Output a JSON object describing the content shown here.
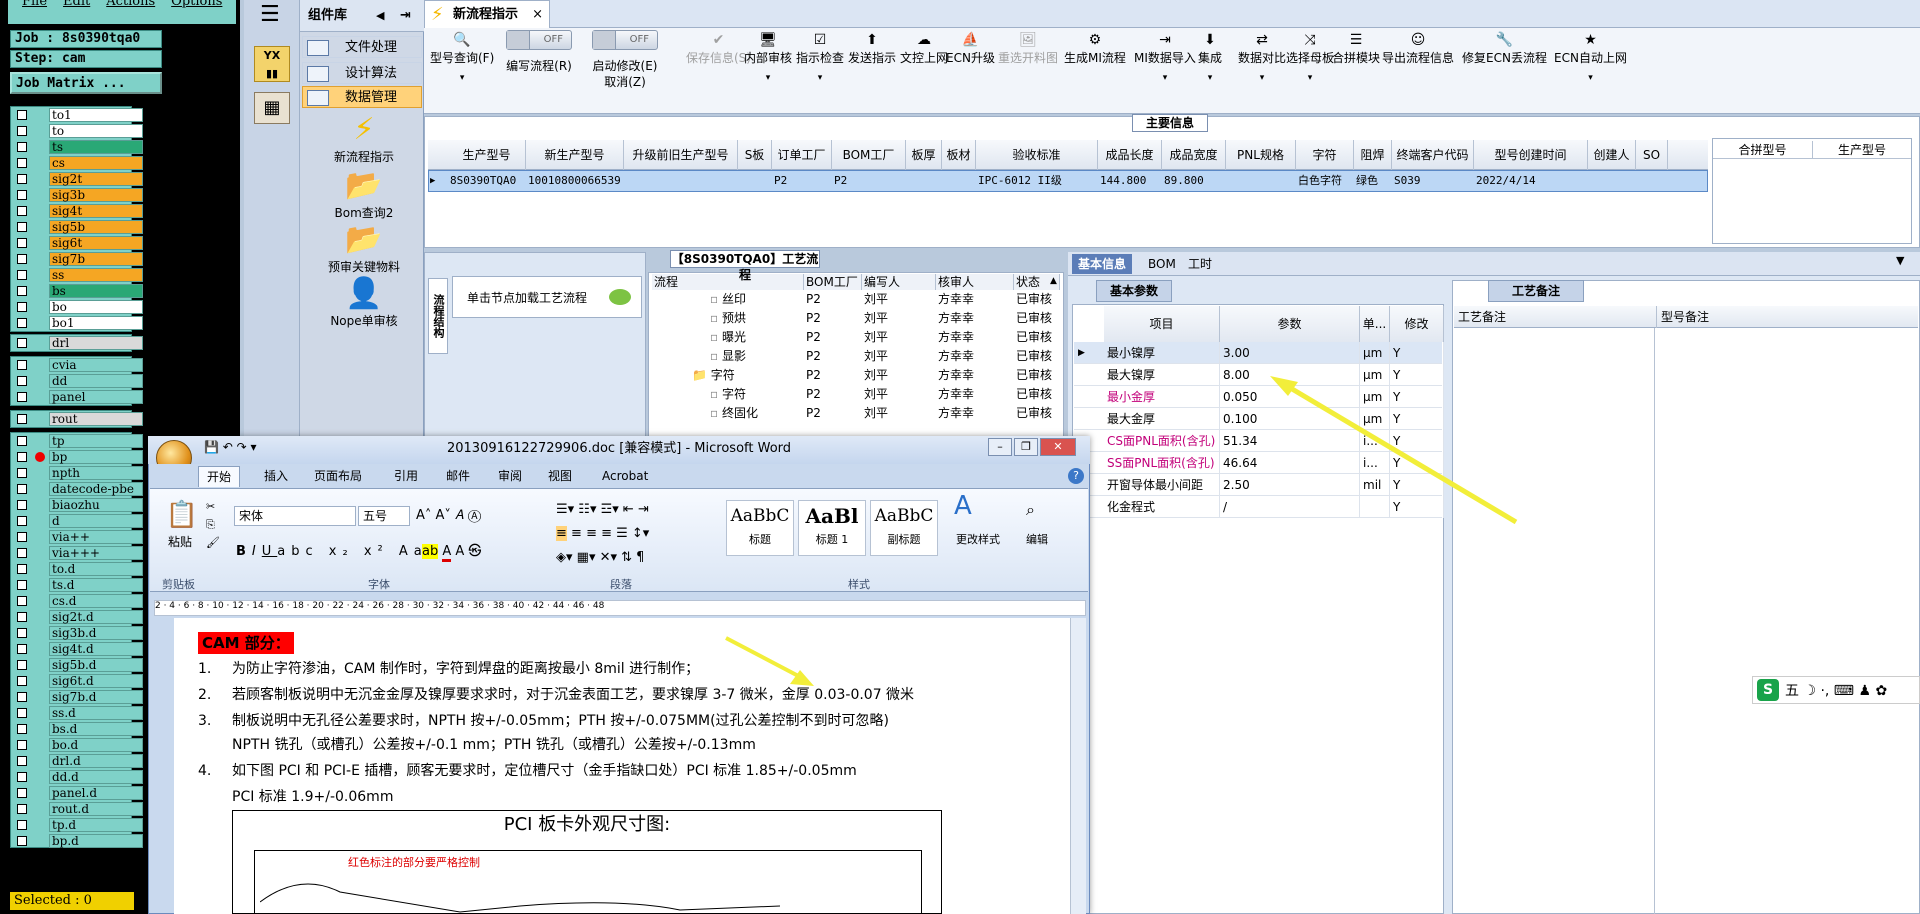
{
  "genesis": {
    "menu": [
      "File",
      "Edit",
      "Actions",
      "Options"
    ],
    "job_label": "Job : 8s0390tqa0",
    "step_label": "Step: cam",
    "matrix_button": "Job Matrix ...",
    "layers": [
      {
        "name": "to1",
        "style": "white",
        "arrow": ""
      },
      {
        "name": "to",
        "style": "white",
        "arrow": "↲"
      },
      {
        "name": "ts",
        "style": "green",
        "arrow": "↲"
      },
      {
        "name": "cs",
        "style": "orange",
        "arrow": "↲"
      },
      {
        "name": "sig2t",
        "style": "orange",
        "arrow": "↲"
      },
      {
        "name": "sig3b",
        "style": "orange",
        "arrow": "↲"
      },
      {
        "name": "sig4t",
        "style": "orange",
        "arrow": "↲"
      },
      {
        "name": "sig5b",
        "style": "orange",
        "arrow": "↲"
      },
      {
        "name": "sig6t",
        "style": "orange",
        "arrow": "↲"
      },
      {
        "name": "sig7b",
        "style": "orange",
        "arrow": "↲"
      },
      {
        "name": "ss",
        "style": "orange",
        "arrow": "↲"
      },
      {
        "name": "bs",
        "style": "green",
        "arrow": "↲"
      },
      {
        "name": "bo",
        "style": "white",
        "arrow": "↲"
      },
      {
        "name": "bo1",
        "style": "white",
        "arrow": ""
      }
    ],
    "drill_layers": [
      {
        "name": "drl",
        "style": "grey",
        "arrow": ""
      }
    ],
    "misc_layers": [
      {
        "name": "cvia",
        "style": "plain",
        "arrow": ""
      },
      {
        "name": "dd",
        "style": "plain",
        "arrow": "↲"
      },
      {
        "name": "panel",
        "style": "plain",
        "arrow": ""
      }
    ],
    "rout_layers": [
      {
        "name": "rout",
        "style": "grey",
        "arrow": ""
      }
    ],
    "doc_layers": [
      "tp",
      "bp",
      "npth",
      "datecode-pbe",
      "biaozhu",
      "d",
      "via++",
      "via+++",
      "to.d",
      "ts.d",
      "cs.d",
      "sig2t.d",
      "sig3b.d",
      "sig4t.d",
      "sig5b.d",
      "sig6t.d",
      "sig7b.d",
      "ss.d",
      "bs.d",
      "bo.d",
      "drl.d",
      "dd.d",
      "panel.d",
      "rout.d",
      "tp.d",
      "bp.d"
    ],
    "selected": "Selected : 0"
  },
  "sidebar": {
    "title": "组件库",
    "items": [
      {
        "label": "文件处理"
      },
      {
        "label": "设计算法"
      },
      {
        "label": "数据管理",
        "active": true
      }
    ],
    "tools": [
      {
        "label": "新流程指示",
        "icon": "lightning-icon",
        "glyph": "⚡"
      },
      {
        "label": "Bom查询2",
        "icon": "folder-icon",
        "glyph": "📂"
      },
      {
        "label": "预审关键物料",
        "icon": "folder-icon",
        "glyph": "📂"
      },
      {
        "label": "Nope单审核",
        "icon": "user-icon",
        "glyph": "👤"
      }
    ]
  },
  "tab": {
    "title": "新流程指示"
  },
  "toolbar": {
    "buttons": [
      {
        "label": "型号查询(F)",
        "icon": "🔍",
        "dd": true,
        "disabled": false
      },
      {
        "label": "保存信息(S)",
        "icon": "✔",
        "dd": false,
        "disabled": true
      },
      {
        "label": "内部审核",
        "icon": "🖥",
        "dd": true,
        "disabled": false
      },
      {
        "label": "指示检查",
        "icon": "☑",
        "dd": true,
        "disabled": false
      },
      {
        "label": "发送指示",
        "icon": "⬆",
        "dd": false,
        "disabled": false
      },
      {
        "label": "文控上网",
        "icon": "☁",
        "dd": false,
        "disabled": false
      },
      {
        "label": "ECN升级",
        "icon": "⛵",
        "dd": false,
        "disabled": false
      },
      {
        "label": "重选开料图",
        "icon": "🖼",
        "dd": false,
        "disabled": true
      },
      {
        "label": "生成MI流程",
        "icon": "⚙",
        "dd": false,
        "disabled": false
      },
      {
        "label": "MI数据导入",
        "icon": "⇥",
        "dd": true,
        "disabled": false
      },
      {
        "label": "集成",
        "icon": "⬇",
        "dd": true,
        "disabled": false
      },
      {
        "label": "数据对比",
        "icon": "⇄",
        "dd": true,
        "disabled": false
      },
      {
        "label": "选择母板",
        "icon": "⤨",
        "dd": true,
        "disabled": false
      },
      {
        "label": "合拼模块",
        "icon": "☰",
        "dd": false,
        "disabled": false
      },
      {
        "label": "导出流程信息",
        "icon": "☺",
        "dd": false,
        "disabled": false
      },
      {
        "label": "修复ECN丢流程",
        "icon": "🔧",
        "dd": false,
        "disabled": false
      },
      {
        "label": "ECN自动上网",
        "icon": "★",
        "dd": true,
        "disabled": false
      }
    ],
    "toggle1": {
      "label": "编写流程(R)",
      "state": "OFF"
    },
    "toggle2": {
      "label": "启动修改(E)",
      "state": "OFF",
      "sub": "取消(Z)"
    }
  },
  "main_info": {
    "title": "主要信息",
    "columns": [
      "生产型号",
      "新生产型号",
      "升级前旧生产型号",
      "S板",
      "订单工厂",
      "BOM工厂",
      "板厚",
      "板材",
      "验收标准",
      "成品长度",
      "成品宽度",
      "PNL规格",
      "字符",
      "阻焊",
      "终端客户代码",
      "型号创建时间",
      "创建人",
      "SO"
    ],
    "row": [
      "8S0390TQA0",
      "10010800066539",
      "",
      "",
      "P2",
      "P2",
      "",
      "",
      "IPC-6012 II级",
      "144.800",
      "89.800",
      "",
      "白色字符",
      "绿色",
      "S039",
      "2022/4/14",
      "",
      ""
    ],
    "right_columns": [
      "合拼型号",
      "生产型号"
    ]
  },
  "process": {
    "label": "【8S0390TQA0】工艺流程",
    "side_tab": "流程结构",
    "click_hint": "单击节点加载工艺流程",
    "headers": [
      "流程",
      "BOM工厂",
      "编写人",
      "核审人",
      "状态"
    ],
    "rows": [
      {
        "name": "丝印",
        "indent": 3,
        "factory": "P2",
        "writer": "刘平",
        "reviewer": "方幸幸",
        "status": "已审核"
      },
      {
        "name": "预烘",
        "indent": 3,
        "factory": "P2",
        "writer": "刘平",
        "reviewer": "方幸幸",
        "status": "已审核"
      },
      {
        "name": "曝光",
        "indent": 3,
        "factory": "P2",
        "writer": "刘平",
        "reviewer": "方幸幸",
        "status": "已审核"
      },
      {
        "name": "显影",
        "indent": 3,
        "factory": "P2",
        "writer": "刘平",
        "reviewer": "方幸幸",
        "status": "已审核"
      },
      {
        "name": "字符",
        "indent": 2,
        "factory": "P2",
        "writer": "刘平",
        "reviewer": "方幸幸",
        "status": "已审核",
        "folder": true
      },
      {
        "name": "字符",
        "indent": 3,
        "factory": "P2",
        "writer": "刘平",
        "reviewer": "方幸幸",
        "status": "已审核"
      },
      {
        "name": "终固化",
        "indent": 3,
        "factory": "P2",
        "writer": "刘平",
        "reviewer": "方幸幸",
        "status": "已审核"
      }
    ]
  },
  "basic_info": {
    "tabs": [
      "基本信息",
      "BOM",
      "工时"
    ],
    "subtab": "基本参数",
    "headers": [
      "项目",
      "参数",
      "单...",
      "修改"
    ],
    "rows": [
      {
        "item": "最小镍厚",
        "value": "3.00",
        "unit": "μm",
        "mod": "Y",
        "pink": false,
        "sel": true
      },
      {
        "item": "最大镍厚",
        "value": "8.00",
        "unit": "μm",
        "mod": "Y",
        "pink": false
      },
      {
        "item": "最小金厚",
        "value": "0.050",
        "unit": "μm",
        "mod": "Y",
        "pink": true
      },
      {
        "item": "最大金厚",
        "value": "0.100",
        "unit": "μm",
        "mod": "Y",
        "pink": false
      },
      {
        "item": "CS面PNL面积(含孔)",
        "value": "51.34",
        "unit": "i...",
        "mod": "Y",
        "pink": true
      },
      {
        "item": "SS面PNL面积(含孔)",
        "value": "46.64",
        "unit": "i...",
        "mod": "Y",
        "pink": true
      },
      {
        "item": "开窗导体最小间距",
        "value": "2.50",
        "unit": "mil",
        "mod": "Y",
        "pink": false
      },
      {
        "item": "化金程式",
        "value": "/",
        "unit": "",
        "mod": "Y",
        "pink": false
      }
    ]
  },
  "remarks": {
    "tab": "工艺备注",
    "col1": "工艺备注",
    "col2": "型号备注"
  },
  "ime": {
    "logo": "S",
    "text": "五 ☽ ·, ⌨ ♟ ✿"
  },
  "word": {
    "title": "20130916122729906.doc [兼容模式] - Microsoft Word",
    "tabs": [
      "开始",
      "插入",
      "页面布局",
      "引用",
      "邮件",
      "审阅",
      "视图",
      "Acrobat"
    ],
    "font": "宋体",
    "size": "五号",
    "paste": "粘贴",
    "groups": [
      "剪贴板",
      "字体",
      "段落",
      "样式"
    ],
    "styles": [
      {
        "sample": "AaBbC",
        "name": "标题"
      },
      {
        "sample": "AaBl",
        "name": "标题 1"
      },
      {
        "sample": "AaBbC",
        "name": "副标题"
      }
    ],
    "change_styles": "更改样式",
    "edit": "编辑",
    "ruler": "2 · 4 · 6 · 8 · 10 · 12 · 14 · 16 · 18 · 20 · 22 · 24 · 26 · 28 · 30 · 32 · 34 · 36 · 38 · 40 · 42 · 44 · 46 · 48",
    "doc": {
      "cam_title": "CAM 部分：",
      "lines": [
        {
          "num": "1.",
          "text": "为防止字符渗油，CAM 制作时，字符到焊盘的距离按最小 8mil 进行制作；"
        },
        {
          "num": "2.",
          "text": "若顾客制板说明中无沉金金厚及镍厚要求求时，对于沉金表面工艺，要求镍厚 3-7 微米，金厚 0.03-0.07 微米"
        },
        {
          "num": "3.",
          "text": "制板说明中无孔径公差要求时，NPTH 按+/-0.05mm；PTH 按+/-0.075MM(过孔公差控制不到时可忽略)"
        },
        {
          "num": "",
          "text": "NPTH 铣孔（或槽孔）公差按+/-0.1 mm；PTH 铣孔（或槽孔）公差按+/-0.13mm"
        },
        {
          "num": "4.",
          "text": "如下图 PCI 和 PCI-E 插槽，顾客无要求时，定位槽尺寸（金手指缺口处）PCI 标准 1.85+/-0.05mm"
        },
        {
          "num": "",
          "text": "PCI 标准 1.9+/-0.06mm"
        }
      ],
      "pci_title": "PCI 板卡外观尺寸图:",
      "pci_red": "红色标注的部分要严格控制"
    }
  }
}
